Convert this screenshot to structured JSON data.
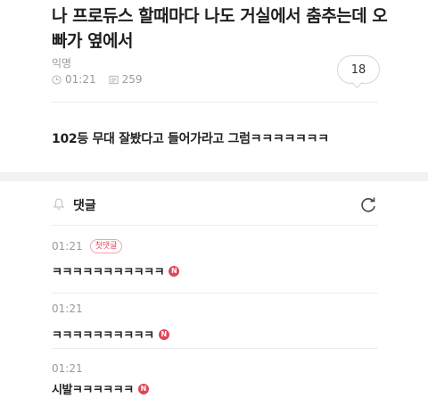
{
  "post": {
    "title": "나 프로듀스 할때마다 나도 거실에서 춤추는데 오빠가 옆에서",
    "author": "익명",
    "time": "01:21",
    "views": "259",
    "comment_count": "18",
    "body": "102등 무대 잘봤다고 들어가라고 그럼ㅋㅋㅋㅋㅋㅋㅋ"
  },
  "comments_section": {
    "title": "댓글"
  },
  "comments": [
    {
      "time": "01:21",
      "badge": "첫댓글",
      "text": "ㅋㅋㅋㅋㅋㅋㅋㅋㅋㅋㅋ",
      "new": "N"
    },
    {
      "time": "01:21",
      "text": "ㅋㅋㅋㅋㅋㅋㅋㅋㅋㅋ",
      "new": "N"
    },
    {
      "time": "01:21",
      "text": "시발ㅋㅋㅋㅋㅋㅋ",
      "new": "N"
    }
  ],
  "colors": {
    "accent": "#e0455a",
    "muted": "#9a9a9a",
    "divider": "#ececec"
  }
}
